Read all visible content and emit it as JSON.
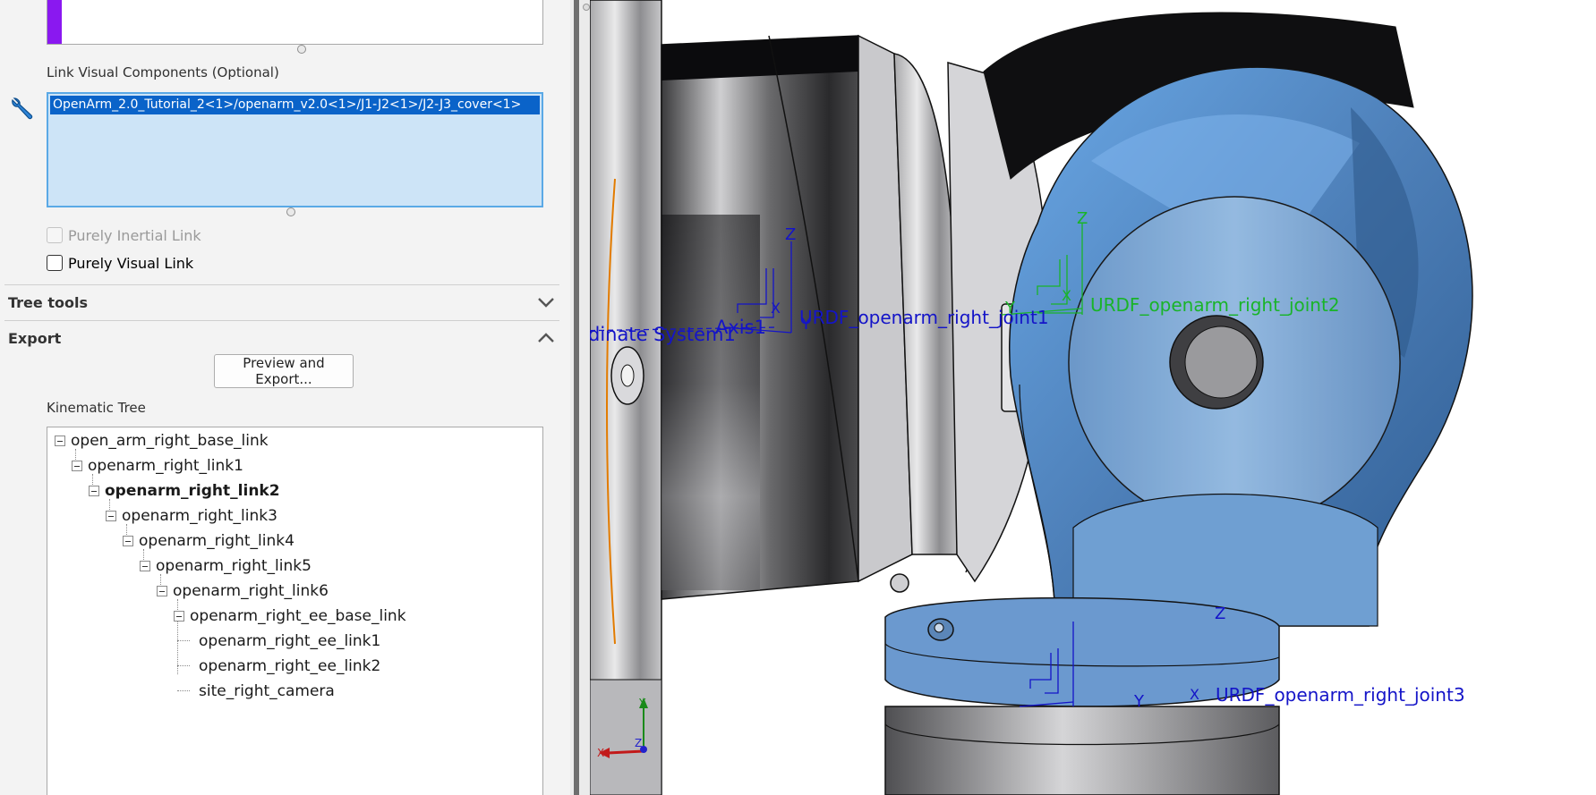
{
  "panel": {
    "link_visual_label": "Link Visual Components (Optional)",
    "link_visual_items": [
      "OpenArm_2.0_Tutorial_2<1>/openarm_v2.0<1>/J1-J2<1>/J2-J3_cover<1>"
    ],
    "purely_inertial_label": "Purely Inertial Link",
    "purely_visual_label": "Purely Visual Link",
    "tree_tools_title": "Tree tools",
    "export_title": "Export",
    "preview_button": "Preview and Export...",
    "kinematic_tree_label": "Kinematic Tree",
    "tree": [
      {
        "label": "open_arm_right_base_link",
        "bold": false
      },
      {
        "label": "openarm_right_link1",
        "bold": false
      },
      {
        "label": "openarm_right_link2",
        "bold": true
      },
      {
        "label": "openarm_right_link3",
        "bold": false
      },
      {
        "label": "openarm_right_link4",
        "bold": false
      },
      {
        "label": "openarm_right_link5",
        "bold": false
      },
      {
        "label": "openarm_right_link6",
        "bold": false
      },
      {
        "label": "openarm_right_ee_base_link",
        "bold": false
      },
      {
        "label": "openarm_right_ee_link1",
        "bold": false
      },
      {
        "label": "openarm_right_ee_link2",
        "bold": false
      },
      {
        "label": "site_right_camera",
        "bold": false
      }
    ]
  },
  "viewport": {
    "coord_label": "dinate System1",
    "axis_label": "Axis1",
    "joint1_label": "URDF_openarm_right_joint1",
    "joint2_label": "URDF_openarm_right_joint2",
    "joint3_label": "URDF_openarm_right_joint3",
    "axis_y": "Y",
    "axis_z": "Z",
    "axis_x": "X",
    "joint_blue": "#1414c8",
    "joint_green": "#19b429",
    "model_blue": "#6e9ccf"
  }
}
